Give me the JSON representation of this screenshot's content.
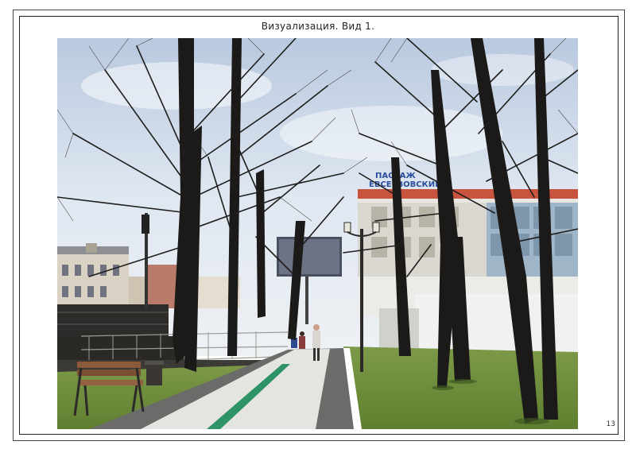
{
  "page": {
    "title": "Визуализация.  Вид 1.",
    "number": "13"
  },
  "scene": {
    "building_sign": "ПАССАЖ\nЕВСЕЕВОВСКИЙ",
    "colors": {
      "sky": "#c9d6e8",
      "lawn": "#6f8f3e",
      "path": "#e2e2de",
      "stripe": "#2e9366",
      "tree": "#1b1a18"
    }
  }
}
